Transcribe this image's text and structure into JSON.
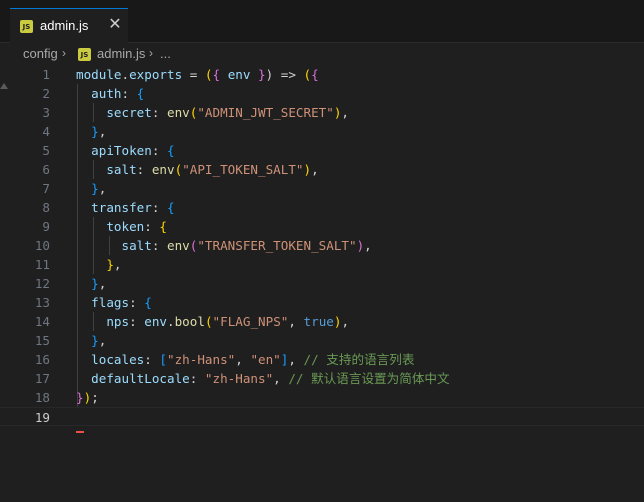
{
  "tab": {
    "title": "admin.js",
    "close_label": "✕",
    "icon_text": "JS"
  },
  "breadcrumb": {
    "folder": "config",
    "file": "admin.js",
    "separator": "›",
    "ellipsis": "..."
  },
  "editor": {
    "current_line": 19,
    "lines": [
      {
        "n": "1",
        "tokens": [
          [
            "v",
            "module"
          ],
          [
            "p",
            "."
          ],
          [
            "v",
            "exports"
          ],
          [
            "o",
            " = "
          ],
          [
            "b1",
            "("
          ],
          [
            "b2",
            "{"
          ],
          [
            "v",
            " env "
          ],
          [
            "b2",
            "}"
          ],
          [
            "o",
            ") => "
          ],
          [
            "b1",
            "("
          ],
          [
            "b2",
            "{"
          ]
        ]
      },
      {
        "n": "2",
        "tokens": [
          [
            "v",
            "  auth"
          ],
          [
            "p",
            ": "
          ],
          [
            "b3",
            "{"
          ]
        ]
      },
      {
        "n": "3",
        "tokens": [
          [
            "v",
            "    secret"
          ],
          [
            "p",
            ": "
          ],
          [
            "f",
            "env"
          ],
          [
            "b1",
            "("
          ],
          [
            "s",
            "\"ADMIN_JWT_SECRET\""
          ],
          [
            "b1",
            ")"
          ],
          [
            "p",
            ","
          ]
        ]
      },
      {
        "n": "4",
        "tokens": [
          [
            "b3",
            "  }"
          ],
          [
            "p",
            ","
          ]
        ]
      },
      {
        "n": "5",
        "tokens": [
          [
            "v",
            "  apiToken"
          ],
          [
            "p",
            ": "
          ],
          [
            "b3",
            "{"
          ]
        ]
      },
      {
        "n": "6",
        "tokens": [
          [
            "v",
            "    salt"
          ],
          [
            "p",
            ": "
          ],
          [
            "f",
            "env"
          ],
          [
            "b1",
            "("
          ],
          [
            "s",
            "\"API_TOKEN_SALT\""
          ],
          [
            "b1",
            ")"
          ],
          [
            "p",
            ","
          ]
        ]
      },
      {
        "n": "7",
        "tokens": [
          [
            "b3",
            "  }"
          ],
          [
            "p",
            ","
          ]
        ]
      },
      {
        "n": "8",
        "tokens": [
          [
            "v",
            "  transfer"
          ],
          [
            "p",
            ": "
          ],
          [
            "b3",
            "{"
          ]
        ]
      },
      {
        "n": "9",
        "tokens": [
          [
            "v",
            "    token"
          ],
          [
            "p",
            ": "
          ],
          [
            "b1",
            "{"
          ]
        ]
      },
      {
        "n": "10",
        "tokens": [
          [
            "v",
            "      salt"
          ],
          [
            "p",
            ": "
          ],
          [
            "f",
            "env"
          ],
          [
            "b2",
            "("
          ],
          [
            "s",
            "\"TRANSFER_TOKEN_SALT\""
          ],
          [
            "b2",
            ")"
          ],
          [
            "p",
            ","
          ]
        ]
      },
      {
        "n": "11",
        "tokens": [
          [
            "b1",
            "    }"
          ],
          [
            "p",
            ","
          ]
        ]
      },
      {
        "n": "12",
        "tokens": [
          [
            "b3",
            "  }"
          ],
          [
            "p",
            ","
          ]
        ]
      },
      {
        "n": "13",
        "tokens": [
          [
            "v",
            "  flags"
          ],
          [
            "p",
            ": "
          ],
          [
            "b3",
            "{"
          ]
        ]
      },
      {
        "n": "14",
        "tokens": [
          [
            "v",
            "    nps"
          ],
          [
            "p",
            ": "
          ],
          [
            "v",
            "env"
          ],
          [
            "p",
            "."
          ],
          [
            "f",
            "bool"
          ],
          [
            "b1",
            "("
          ],
          [
            "s",
            "\"FLAG_NPS\""
          ],
          [
            "p",
            ", "
          ],
          [
            "bl",
            "true"
          ],
          [
            "b1",
            ")"
          ],
          [
            "p",
            ","
          ]
        ]
      },
      {
        "n": "15",
        "tokens": [
          [
            "b3",
            "  }"
          ],
          [
            "p",
            ","
          ]
        ]
      },
      {
        "n": "16",
        "tokens": [
          [
            "v",
            "  locales"
          ],
          [
            "p",
            ": "
          ],
          [
            "b3",
            "["
          ],
          [
            "s",
            "\"zh-Hans\""
          ],
          [
            "p",
            ", "
          ],
          [
            "s",
            "\"en\""
          ],
          [
            "b3",
            "]"
          ],
          [
            "p",
            ", "
          ],
          [
            "c",
            "// 支持的语言列表"
          ]
        ]
      },
      {
        "n": "17",
        "tokens": [
          [
            "v",
            "  defaultLocale"
          ],
          [
            "p",
            ": "
          ],
          [
            "s",
            "\"zh-Hans\""
          ],
          [
            "p",
            ", "
          ],
          [
            "c",
            "// 默认语言设置为简体中文"
          ]
        ]
      },
      {
        "n": "18",
        "tokens": [
          [
            "b2",
            "}"
          ],
          [
            "b1",
            ")"
          ],
          [
            "p",
            ";"
          ]
        ]
      },
      {
        "n": "19",
        "tokens": []
      }
    ]
  }
}
